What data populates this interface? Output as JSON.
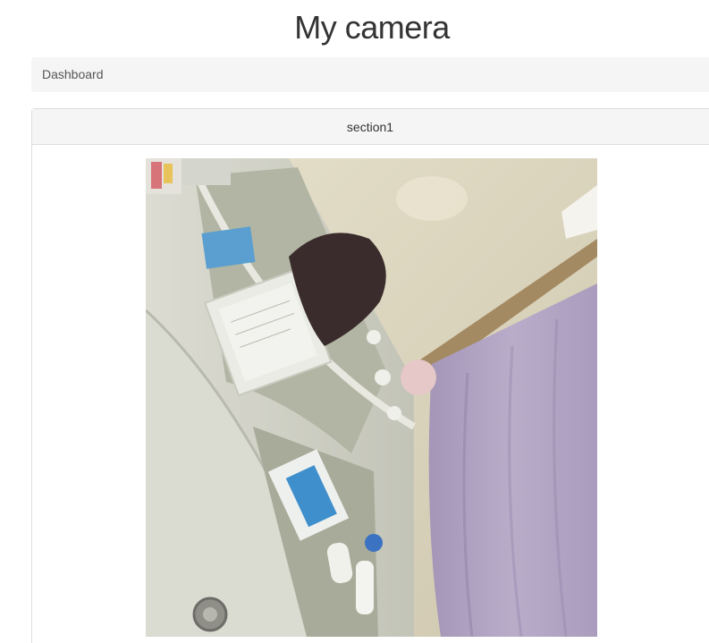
{
  "header": {
    "title": "My camera"
  },
  "breadcrumb": {
    "label": "Dashboard"
  },
  "panel": {
    "heading": "section1"
  }
}
